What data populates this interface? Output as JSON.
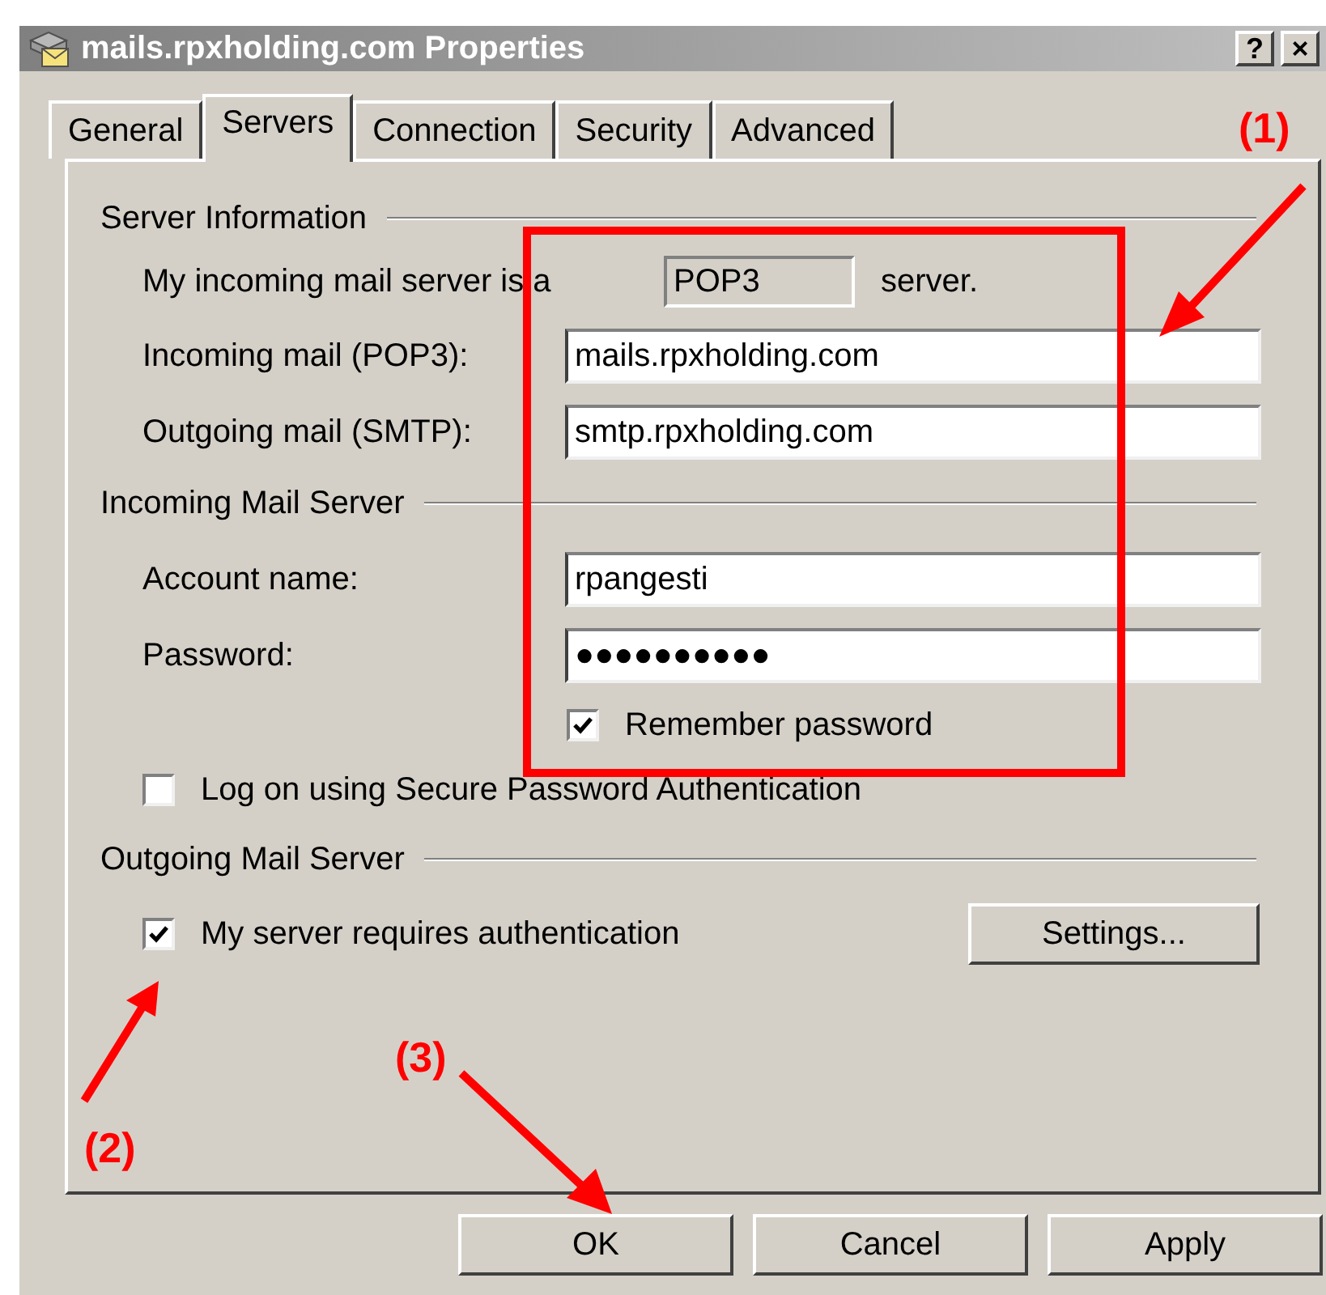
{
  "window": {
    "title": "mails.rpxholding.com Properties",
    "buttons": [
      "?",
      "×"
    ]
  },
  "tabs": [
    {
      "label": "General",
      "selected": false
    },
    {
      "label": "Servers",
      "selected": true
    },
    {
      "label": "Connection",
      "selected": false
    },
    {
      "label": "Security",
      "selected": false
    },
    {
      "label": "Advanced",
      "selected": false
    }
  ],
  "server_information": {
    "heading": "Server Information",
    "type_prefix": "My incoming mail server is a",
    "server_type": "POP3",
    "type_suffix": "server.",
    "fields": [
      {
        "label": "Incoming mail (POP3):",
        "value": "mails.rpxholding.com"
      },
      {
        "label": "Outgoing mail (SMTP):",
        "value": "smtp.rpxholding.com"
      }
    ]
  },
  "incoming_mail_server": {
    "heading": "Incoming Mail Server",
    "fields": [
      {
        "label": "Account name:",
        "value": "rpangesti"
      },
      {
        "label": "Password:",
        "value": "●●●●●●●●●●"
      }
    ],
    "remember_password": {
      "label": "Remember password",
      "checked": true
    },
    "secure_auth": {
      "label": "Log on using Secure Password Authentication",
      "checked": false
    }
  },
  "outgoing_mail_server": {
    "heading": "Outgoing Mail Server",
    "requires_auth": {
      "label": "My server requires authentication",
      "checked": true
    },
    "settings_button": "Settings..."
  },
  "buttons": [
    "OK",
    "Cancel",
    "Apply"
  ],
  "annotations": [
    {
      "label": "(1)"
    },
    {
      "label": "(2)"
    },
    {
      "label": "(3)"
    }
  ]
}
